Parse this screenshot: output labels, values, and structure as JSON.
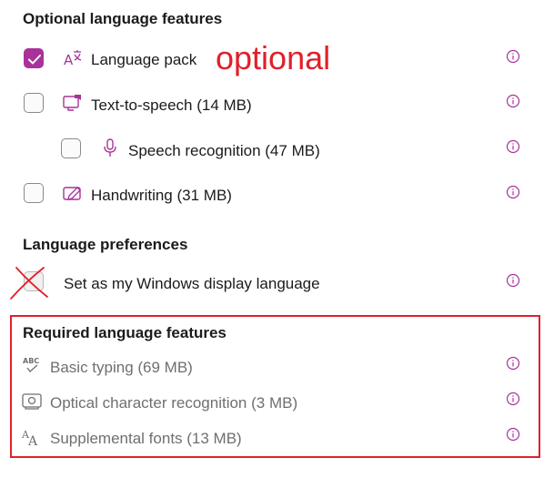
{
  "optional_section": {
    "title": "Optional language features",
    "items": [
      {
        "label": "Language pack",
        "checked": true,
        "icon": "language-pack-icon"
      },
      {
        "label": "Text-to-speech (14 MB)",
        "checked": false,
        "icon": "text-to-speech-icon"
      },
      {
        "label": "Speech recognition (47 MB)",
        "checked": false,
        "icon": "microphone-icon"
      },
      {
        "label": "Handwriting (31 MB)",
        "checked": false,
        "icon": "handwriting-icon"
      }
    ]
  },
  "annotation": {
    "text": "optional",
    "color": "#e0202a"
  },
  "preferences_section": {
    "title": "Language preferences",
    "display_language": {
      "label": "Set as my Windows display language",
      "checked": false
    }
  },
  "required_section": {
    "title": "Required language features",
    "items": [
      {
        "label": "Basic typing (69 MB)",
        "icon": "spellcheck-icon"
      },
      {
        "label": "Optical character recognition (3 MB)",
        "icon": "ocr-icon"
      },
      {
        "label": "Supplemental fonts (13 MB)",
        "icon": "fonts-icon"
      }
    ]
  },
  "colors": {
    "accent": "#a8329a",
    "annotation_red": "#e0202a",
    "muted_text": "#6f6f6f"
  }
}
